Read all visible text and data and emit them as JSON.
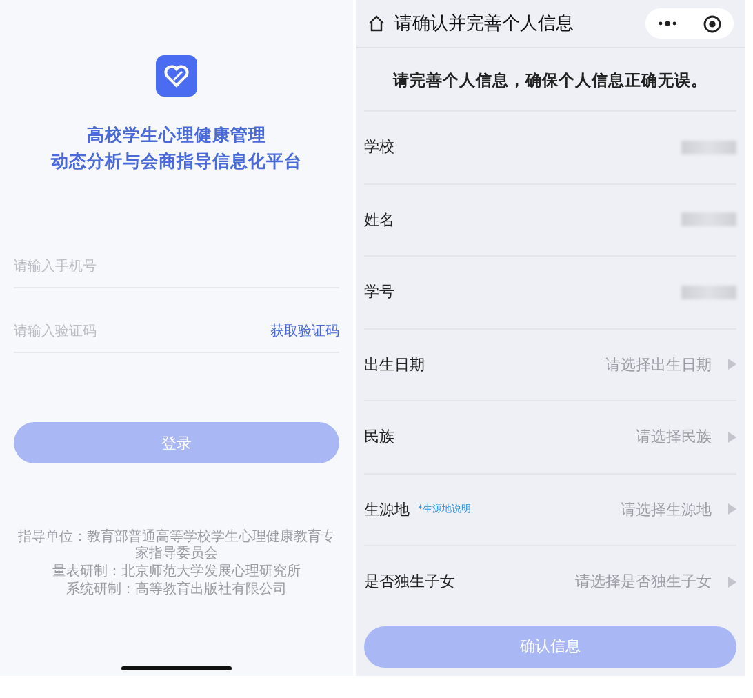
{
  "login": {
    "title_lines": [
      "高校学生心理健康管理",
      "动态分析与会商指导信息化平台"
    ],
    "phone_field": {
      "placeholder": "请输入手机号"
    },
    "code_field": {
      "placeholder": "请输入验证码"
    },
    "get_code_link": "获取验证码",
    "login_button": {
      "label": "登录",
      "disabled": true
    },
    "footer_lines": [
      "指导单位：教育部普通高等学校学生心理健康教育专家指导委员会",
      "量表研制：北京师范大学发展心理研究所",
      "系统研制：高等教育出版社有限公司"
    ]
  },
  "profile": {
    "title": "请确认并完善个人信息",
    "notice": "请完善个人信息，确保个人信息正确无误。",
    "rows": [
      {
        "kind": "masked",
        "label": "学校"
      },
      {
        "kind": "masked",
        "label": "姓名"
      },
      {
        "kind": "masked",
        "label": "学号"
      },
      {
        "kind": "select",
        "label": "出生日期",
        "placeholder": "请选择出生日期"
      },
      {
        "kind": "select",
        "label": "民族",
        "placeholder": "请选择民族"
      },
      {
        "kind": "select",
        "label": "生源地",
        "note": "*生源地说明",
        "placeholder": "请选择生源地"
      },
      {
        "kind": "select",
        "label": "是否独生子女",
        "placeholder": "请选择是否独生子女"
      }
    ],
    "confirm_button": {
      "label": "确认信息",
      "disabled": true
    }
  }
}
